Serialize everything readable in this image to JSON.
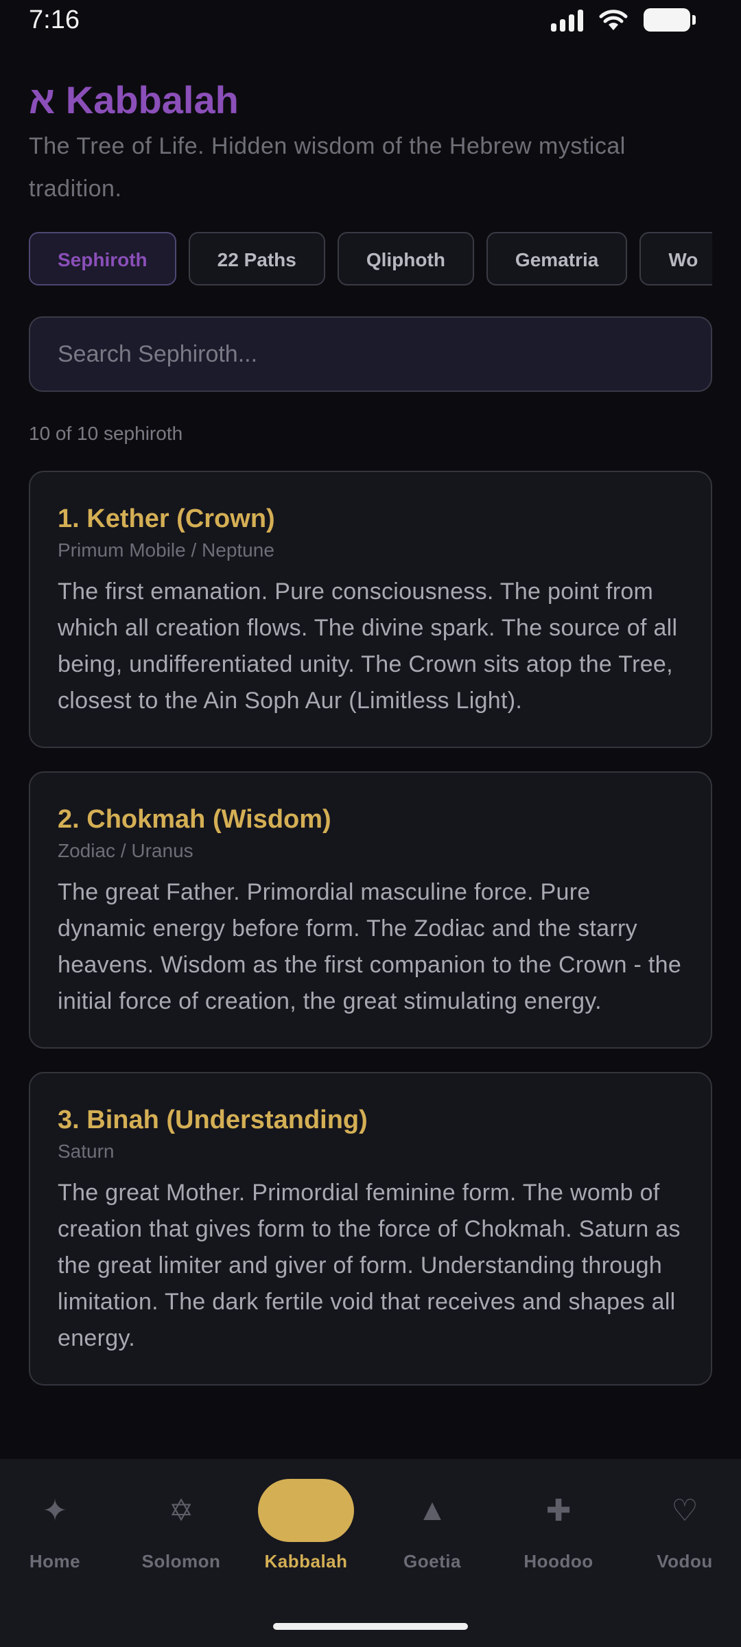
{
  "status_bar": {
    "time": "7:16"
  },
  "header": {
    "title": "א Kabbalah",
    "subtitle": "The Tree of Life. Hidden wisdom of the Hebrew mystical tradition."
  },
  "tabs": [
    {
      "label": "Sephiroth",
      "active": true
    },
    {
      "label": "22 Paths"
    },
    {
      "label": "Qliphoth"
    },
    {
      "label": "Gematria"
    },
    {
      "label": "Wo"
    }
  ],
  "search": {
    "placeholder": "Search Sephiroth...",
    "value": ""
  },
  "result_count": "10 of 10 sephiroth",
  "cards": [
    {
      "title": "1. Kether (Crown)",
      "subtitle": "Primum Mobile / Neptune",
      "body": "The first emanation. Pure consciousness. The point from which all creation flows. The divine spark. The source of all being, undifferentiated unity. The Crown sits atop the Tree, closest to the Ain Soph Aur (Limitless Light)."
    },
    {
      "title": "2. Chokmah (Wisdom)",
      "subtitle": "Zodiac / Uranus",
      "body": "The great Father. Primordial masculine force. Pure dynamic energy before form. The Zodiac and the starry heavens. Wisdom as the first companion to the Crown - the initial force of creation, the great stimulating energy."
    },
    {
      "title": "3. Binah (Understanding)",
      "subtitle": "Saturn",
      "body": "The great Mother. Primordial feminine form. The womb of creation that gives form to the force of Chokmah. Saturn as the great limiter and giver of form. Understanding through limitation. The dark fertile void that receives and shapes all energy."
    }
  ],
  "bottom_nav": [
    {
      "label": "Home",
      "icon": "sparkle-icon",
      "glyph": "✦"
    },
    {
      "label": "Solomon",
      "icon": "hexagram-icon",
      "glyph": "✡"
    },
    {
      "label": "Kabbalah",
      "icon": "active-pill",
      "active": true
    },
    {
      "label": "Goetia",
      "icon": "triangle-icon",
      "glyph": "▲"
    },
    {
      "label": "Hoodoo",
      "icon": "cross-icon",
      "glyph": "✚"
    },
    {
      "label": "Vodou",
      "icon": "heart-icon",
      "glyph": "♡"
    }
  ],
  "colors": {
    "background": "#0c0c10",
    "purple_accent": "#8b4fb9",
    "gold_accent": "#d4af54"
  }
}
